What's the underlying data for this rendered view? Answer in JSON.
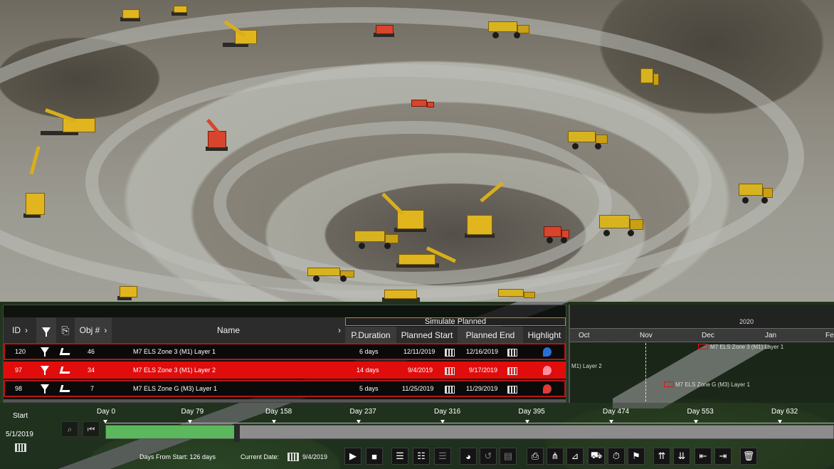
{
  "grid": {
    "columns": {
      "id": "ID",
      "obj": "Obj #",
      "name": "Name",
      "simulate": "Simulate Planned",
      "pduration": "P.Duration",
      "planned_start": "Planned Start",
      "planned_end": "Planned End",
      "highlight": "Highlight"
    },
    "rows": [
      {
        "id": "120",
        "obj": "46",
        "name": "M7 ELS Zone 3 (M1) Layer 1",
        "pduration": "6 days",
        "start": "12/11/2019",
        "end": "12/16/2019",
        "highlight_color": "#2a6fd6",
        "selected": false
      },
      {
        "id": "97",
        "obj": "34",
        "name": "M7 ELS Zone 3 (M1) Layer 2",
        "pduration": "14 days",
        "start": "9/4/2019",
        "end": "9/17/2019",
        "highlight_color": "#ff8fa0",
        "selected": true
      },
      {
        "id": "98",
        "obj": "7",
        "name": "M7 ELS Zone G (M3) Layer 1",
        "pduration": "5 days",
        "start": "11/25/2019",
        "end": "11/29/2019",
        "highlight_color": "#e03a3a",
        "selected": false
      }
    ]
  },
  "gantt": {
    "year": "2020",
    "months": [
      "Oct",
      "Nov",
      "Dec",
      "Jan",
      "Feb"
    ],
    "bars": [
      {
        "label": "M7 ELS Zone 3 (M1) Layer 1"
      },
      {
        "label": "M1) Layer 2"
      },
      {
        "label": "M7 ELS Zone G (M3) Layer 1"
      }
    ]
  },
  "timeline": {
    "start_label": "Start",
    "start_date": "5/1/2019",
    "days": [
      "Day 0",
      "Day 79",
      "Day 158",
      "Day 237",
      "Day 316",
      "Day 395",
      "Day 474",
      "Day 553",
      "Day 632"
    ],
    "days_from_start": "Days From Start: 126 days",
    "current_date_label": "Current Date:",
    "current_date": "9/4/2019",
    "progress": 0.176,
    "colors": {
      "progress": "#5cb85c",
      "selected_row": "#e10c0c",
      "row_border": "#b51515"
    }
  },
  "toolbar": {
    "icons": [
      "play-icon",
      "stop-icon",
      "add-task-icon",
      "remove-task-icon",
      "task-list-icon",
      "palette-icon",
      "reset-icon",
      "report-icon",
      "export-icon",
      "link-icon",
      "filter-tasks-icon",
      "equipment-icon",
      "timer-icon",
      "flag-icon",
      "move-up-icon",
      "move-down-icon",
      "outdent-icon",
      "indent-icon",
      "delete-icon"
    ]
  }
}
